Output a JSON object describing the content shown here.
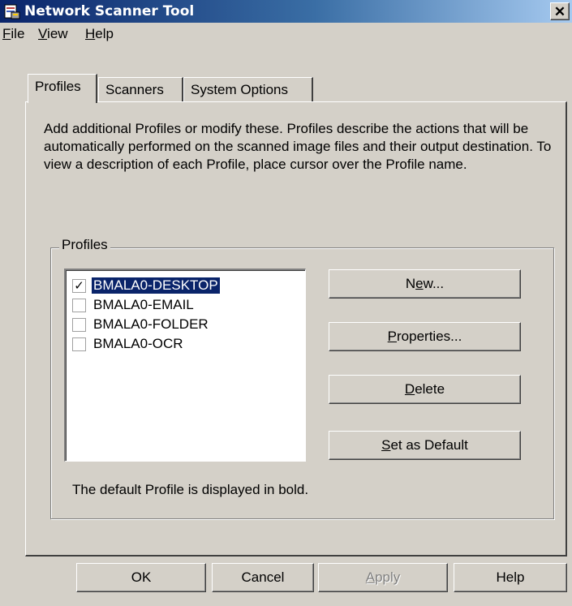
{
  "window": {
    "title": "Network Scanner Tool",
    "close_glyph": "✕"
  },
  "menu": [
    "File",
    "View",
    "Help"
  ],
  "tabs": [
    {
      "label": "Profiles",
      "active": true
    },
    {
      "label": "Scanners",
      "active": false
    },
    {
      "label": "System Options",
      "active": false
    }
  ],
  "description": "Add additional Profiles or modify these. Profiles describe the actions that will be automatically performed on the scanned image files and their output destination. To view a description of each  Profile, place cursor over the Profile name.",
  "profiles_group": {
    "label": "Profiles",
    "items": [
      {
        "name": "BMALA0-DESKTOP",
        "checked": true,
        "selected": true
      },
      {
        "name": "BMALA0-EMAIL",
        "checked": false,
        "selected": false
      },
      {
        "name": "BMALA0-FOLDER",
        "checked": false,
        "selected": false
      },
      {
        "name": "BMALA0-OCR",
        "checked": false,
        "selected": false
      }
    ],
    "buttons": {
      "new": {
        "pre": "N",
        "mn": "e",
        "post": "w..."
      },
      "properties": {
        "pre": "",
        "mn": "P",
        "post": "roperties..."
      },
      "delete": {
        "pre": "",
        "mn": "D",
        "post": "elete"
      },
      "set_default": {
        "pre": "",
        "mn": "S",
        "post": "et as Default"
      }
    },
    "footnote": "The default Profile is displayed in bold."
  },
  "dialog_buttons": {
    "ok": "OK",
    "cancel": "Cancel",
    "apply": {
      "pre": "",
      "mn": "A",
      "post": "pply"
    },
    "help": "Help"
  },
  "colors": {
    "titlebar": "#0a246a",
    "face": "#d4d0c8",
    "selection": "#0a246a"
  }
}
